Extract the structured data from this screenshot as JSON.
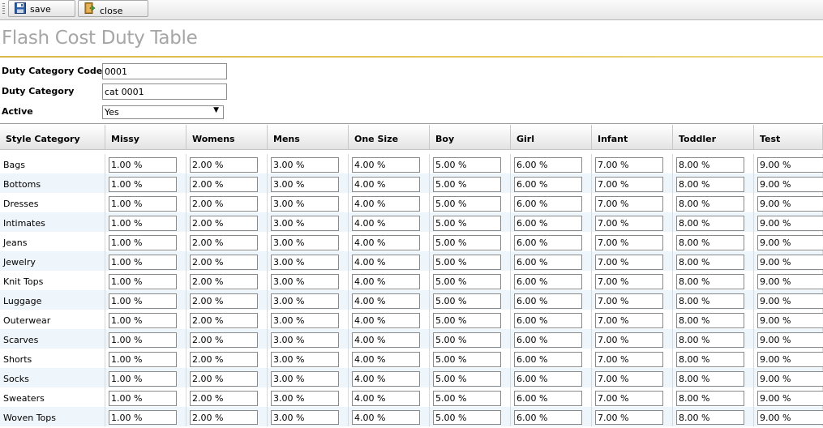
{
  "toolbar": {
    "save_label": "save",
    "close_label": "close"
  },
  "page": {
    "title": "Flash Cost Duty Table"
  },
  "form": {
    "code_label": "Duty Category Code",
    "code_value": "0001",
    "category_label": "Duty Category",
    "category_value": "cat 0001",
    "active_label": "Active",
    "active_value": "Yes"
  },
  "grid": {
    "columns": [
      "Style Category",
      "Missy",
      "Womens",
      "Mens",
      "One Size",
      "Boy",
      "Girl",
      "Infant",
      "Toddler",
      "Test"
    ],
    "rows": [
      {
        "name": "Bags",
        "values": [
          "1.00 %",
          "2.00 %",
          "3.00 %",
          "4.00 %",
          "5.00 %",
          "6.00 %",
          "7.00 %",
          "8.00 %",
          "9.00 %"
        ]
      },
      {
        "name": "Bottoms",
        "values": [
          "1.00 %",
          "2.00 %",
          "3.00 %",
          "4.00 %",
          "5.00 %",
          "6.00 %",
          "7.00 %",
          "8.00 %",
          "9.00 %"
        ]
      },
      {
        "name": "Dresses",
        "values": [
          "1.00 %",
          "2.00 %",
          "3.00 %",
          "4.00 %",
          "5.00 %",
          "6.00 %",
          "7.00 %",
          "8.00 %",
          "9.00 %"
        ]
      },
      {
        "name": "Intimates",
        "values": [
          "1.00 %",
          "2.00 %",
          "3.00 %",
          "4.00 %",
          "5.00 %",
          "6.00 %",
          "7.00 %",
          "8.00 %",
          "9.00 %"
        ]
      },
      {
        "name": "Jeans",
        "values": [
          "1.00 %",
          "2.00 %",
          "3.00 %",
          "4.00 %",
          "5.00 %",
          "6.00 %",
          "7.00 %",
          "8.00 %",
          "9.00 %"
        ]
      },
      {
        "name": "Jewelry",
        "values": [
          "1.00 %",
          "2.00 %",
          "3.00 %",
          "4.00 %",
          "5.00 %",
          "6.00 %",
          "7.00 %",
          "8.00 %",
          "9.00 %"
        ]
      },
      {
        "name": "Knit Tops",
        "values": [
          "1.00 %",
          "2.00 %",
          "3.00 %",
          "4.00 %",
          "5.00 %",
          "6.00 %",
          "7.00 %",
          "8.00 %",
          "9.00 %"
        ]
      },
      {
        "name": "Luggage",
        "values": [
          "1.00 %",
          "2.00 %",
          "3.00 %",
          "4.00 %",
          "5.00 %",
          "6.00 %",
          "7.00 %",
          "8.00 %",
          "9.00 %"
        ]
      },
      {
        "name": "Outerwear",
        "values": [
          "1.00 %",
          "2.00 %",
          "3.00 %",
          "4.00 %",
          "5.00 %",
          "6.00 %",
          "7.00 %",
          "8.00 %",
          "9.00 %"
        ]
      },
      {
        "name": "Scarves",
        "values": [
          "1.00 %",
          "2.00 %",
          "3.00 %",
          "4.00 %",
          "5.00 %",
          "6.00 %",
          "7.00 %",
          "8.00 %",
          "9.00 %"
        ]
      },
      {
        "name": "Shorts",
        "values": [
          "1.00 %",
          "2.00 %",
          "3.00 %",
          "4.00 %",
          "5.00 %",
          "6.00 %",
          "7.00 %",
          "8.00 %",
          "9.00 %"
        ]
      },
      {
        "name": "Socks",
        "values": [
          "1.00 %",
          "2.00 %",
          "3.00 %",
          "4.00 %",
          "5.00 %",
          "6.00 %",
          "7.00 %",
          "8.00 %",
          "9.00 %"
        ]
      },
      {
        "name": "Sweaters",
        "values": [
          "1.00 %",
          "2.00 %",
          "3.00 %",
          "4.00 %",
          "5.00 %",
          "6.00 %",
          "7.00 %",
          "8.00 %",
          "9.00 %"
        ]
      },
      {
        "name": "Woven Tops",
        "values": [
          "1.00 %",
          "2.00 %",
          "3.00 %",
          "4.00 %",
          "5.00 %",
          "6.00 %",
          "7.00 %",
          "8.00 %",
          "9.00 %"
        ]
      }
    ]
  },
  "colors": {
    "title": "#a6a6a6",
    "rule": "#e8c75a",
    "row_alt": "#eef5fb"
  }
}
